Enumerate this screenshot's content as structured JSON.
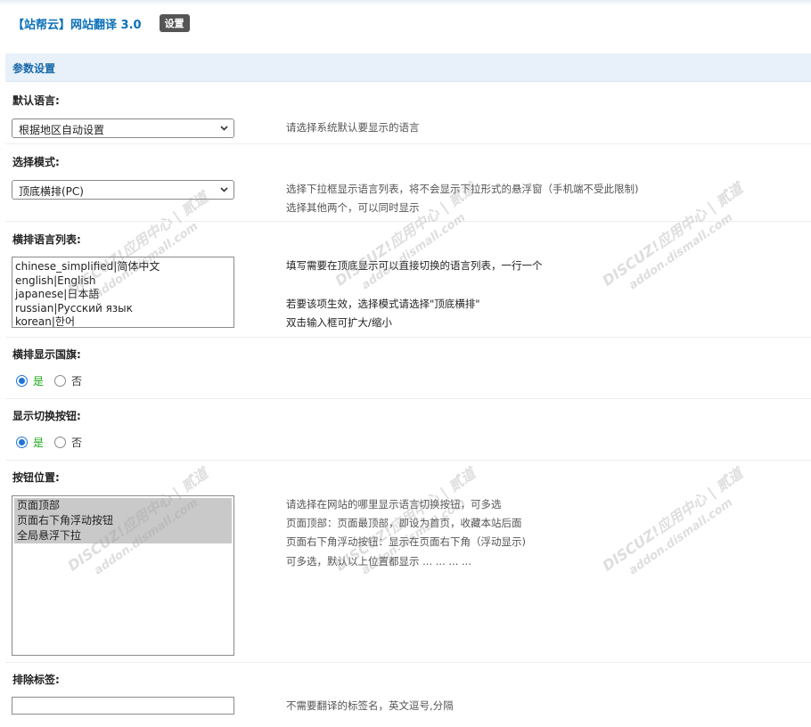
{
  "header": {
    "title": "【站帮云】网站翻译 3.0",
    "badge": "设置"
  },
  "section": {
    "title": "参数设置"
  },
  "default_language": {
    "label": "默认语言:",
    "selected": "根据地区自动设置",
    "desc": "请选择系统默认要显示的语言"
  },
  "select_mode": {
    "label": "选择模式:",
    "selected": "顶底横排(PC)",
    "desc_line1": "选择下拉框显示语言列表，将不会显示下拉形式的悬浮窗（手机端不受此限制)",
    "desc_line2": "选择其他两个，可以同时显示"
  },
  "language_list": {
    "label": "横排语言列表:",
    "lines": [
      "chinese_simplified|简体中文",
      "english|English",
      "japanese|日本語",
      "russian|Русский язык",
      "korean|한어"
    ],
    "desc_line1": "填写需要在顶底显示可以直接切换的语言列表，一行一个",
    "desc_line2": "若要该项生效，选择模式请选择\"顶底横排\"",
    "desc_line3": "双击输入框可扩大/缩小"
  },
  "show_flag": {
    "label": "横排显示国旗:",
    "yes": "是",
    "no": "否",
    "value": "yes"
  },
  "show_switch": {
    "label": "显示切换按钮:",
    "yes": "是",
    "no": "否",
    "value": "yes"
  },
  "button_position": {
    "label": "按钮位置:",
    "options": [
      "页面顶部",
      "页面右下角浮动按钮",
      "全局悬浮下拉"
    ],
    "desc_line1": "请选择在网站的哪里显示语言切换按钮，可多选",
    "desc_line2": "页面顶部：页面最顶部，即设为首页，收藏本站后面",
    "desc_line3": "页面右下角浮动按钮：显示在页面右下角（浮动显示)",
    "desc_line4": "可多选，默认以上位置都显示 ... ... ... ..."
  },
  "exclude_tags": {
    "label": "排除标签:",
    "value": "",
    "desc": "不需要翻译的标签名，英文逗号,分隔"
  },
  "watermark": {
    "text": "DISCUZ!应用中心 | 贰道",
    "sub": "addon.dismall.com"
  },
  "colors": {
    "title": "#0b70b8",
    "section_bg": "#e8f1fa",
    "yes_green": "#1aa81a",
    "radio_blue": "#1f74d6"
  }
}
